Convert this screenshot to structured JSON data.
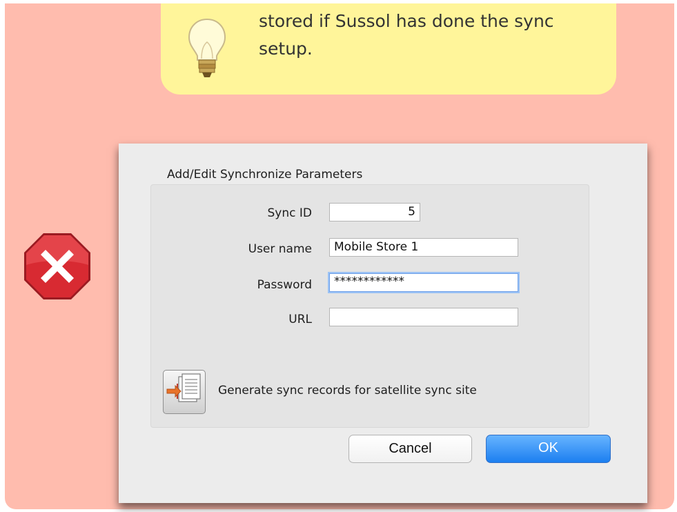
{
  "tip": {
    "text_line1": "stored if Sussol has done the sync",
    "text_line2": "setup.",
    "icon": "lightbulb-icon"
  },
  "warning": {
    "icon": "error-stop-icon",
    "colors": {
      "background": "#ffbcae",
      "tip_background": "#fff59a",
      "error_red": "#c8202a"
    }
  },
  "dialog": {
    "group_title": "Add/Edit Synchronize Parameters",
    "fields": {
      "sync_id": {
        "label": "Sync ID",
        "value": "5"
      },
      "user_name": {
        "label": "User name",
        "value": "Mobile Store 1"
      },
      "password": {
        "label": "Password",
        "value": "************"
      },
      "url": {
        "label": "URL",
        "value": ""
      }
    },
    "generate_label": "Generate sync records for satellite sync site",
    "cancel_label": "Cancel",
    "ok_label": "OK",
    "colors": {
      "ok_button": "#2586f3",
      "focus_ring": "#9cc3f5"
    }
  }
}
